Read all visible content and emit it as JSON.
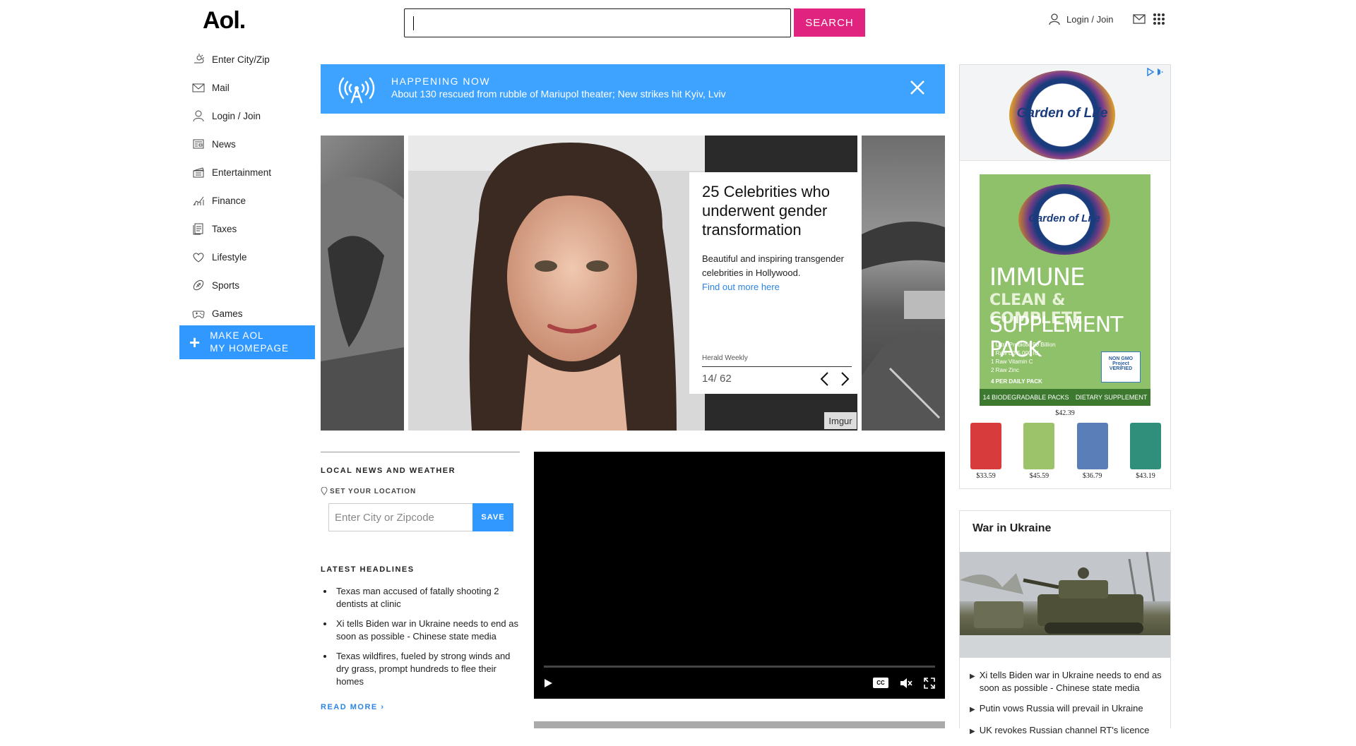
{
  "header": {
    "logo": "Aol.",
    "search_placeholder": "",
    "search_button": "SEARCH",
    "login": "Login / Join",
    "icons": [
      "user-icon",
      "mail-icon",
      "apps-grid-icon"
    ]
  },
  "nav": {
    "items": [
      {
        "label": "Enter City/Zip",
        "icon": "weather-icon"
      },
      {
        "label": "Mail",
        "icon": "mail-icon"
      },
      {
        "label": "Login / Join",
        "icon": "user-icon"
      },
      {
        "label": "News",
        "icon": "news-icon"
      },
      {
        "label": "Entertainment",
        "icon": "clapper-icon"
      },
      {
        "label": "Finance",
        "icon": "chart-icon"
      },
      {
        "label": "Taxes",
        "icon": "document-icon"
      },
      {
        "label": "Lifestyle",
        "icon": "heart-icon"
      },
      {
        "label": "Sports",
        "icon": "football-icon"
      },
      {
        "label": "Games",
        "icon": "gamepad-icon"
      }
    ],
    "make_homepage_line1": "MAKE AOL",
    "make_homepage_line2": "MY HOMEPAGE"
  },
  "happening": {
    "title": "HAPPENING NOW",
    "text": "About 130 rescued from rubble of Mariupol theater; New strikes hit Kyiv, Lviv"
  },
  "carousel": {
    "title": "25 Celebrities who underwent gender transformation",
    "description": "Beautiful and inspiring transgender celebrities in Hollywood.",
    "link": "Find out more here",
    "source": "Herald Weekly",
    "counter": "14/ 62",
    "credit": "Imgur"
  },
  "local": {
    "heading": "LOCAL NEWS AND WEATHER",
    "set_location": "SET YOUR LOCATION",
    "zip_placeholder": "Enter City or Zipcode",
    "save": "SAVE",
    "latest_heading": "LATEST HEADLINES",
    "headlines": [
      "Texas man accused of fatally shooting 2 dentists at clinic",
      "Xi tells Biden war in Ukraine needs to end as soon as possible - Chinese state media",
      "Texas wildfires, fueled by strong winds and dry grass, prompt hundreds to flee their homes"
    ],
    "read_more": "READ MORE ›"
  },
  "video": {
    "cc": "CC"
  },
  "ad": {
    "brand": "Garden of Life",
    "product_line1": "IMMUNE",
    "product_line2": "CLEAN & COMPLETE",
    "product_line3": "SUPPLEMENT PACK",
    "bullets": [
      "1  Ultra Probiotic 90 Billion",
      "1  Raw D3 5,000 IU",
      "1  Raw Vitamin C",
      "2  Raw Zinc"
    ],
    "daily": "4 PER DAILY PACK",
    "bottom_left": "14 BIODEGRADABLE PACKS",
    "bottom_right": "DIETARY SUPPLEMENT",
    "nongmo": "NON GMO Project VERIFIED",
    "main_price": "$42.39",
    "thumb_prices": [
      "$33.59",
      "$45.59",
      "$36.79",
      "$43.19"
    ],
    "thumb_colors": [
      "#d73b3b",
      "#9cc36a",
      "#5a7fb8",
      "#2f8f7a"
    ]
  },
  "ukraine": {
    "heading": "War in Ukraine",
    "links": [
      "Xi tells Biden war in Ukraine needs to end as soon as possible - Chinese state media",
      "Putin vows Russia will prevail in Ukraine",
      "UK revokes Russian channel RT's licence"
    ]
  },
  "colors": {
    "accent_pink": "#e0237f",
    "accent_blue": "#3198ff",
    "banner_blue": "#3ea3ff",
    "link_blue": "#2b85e4"
  }
}
